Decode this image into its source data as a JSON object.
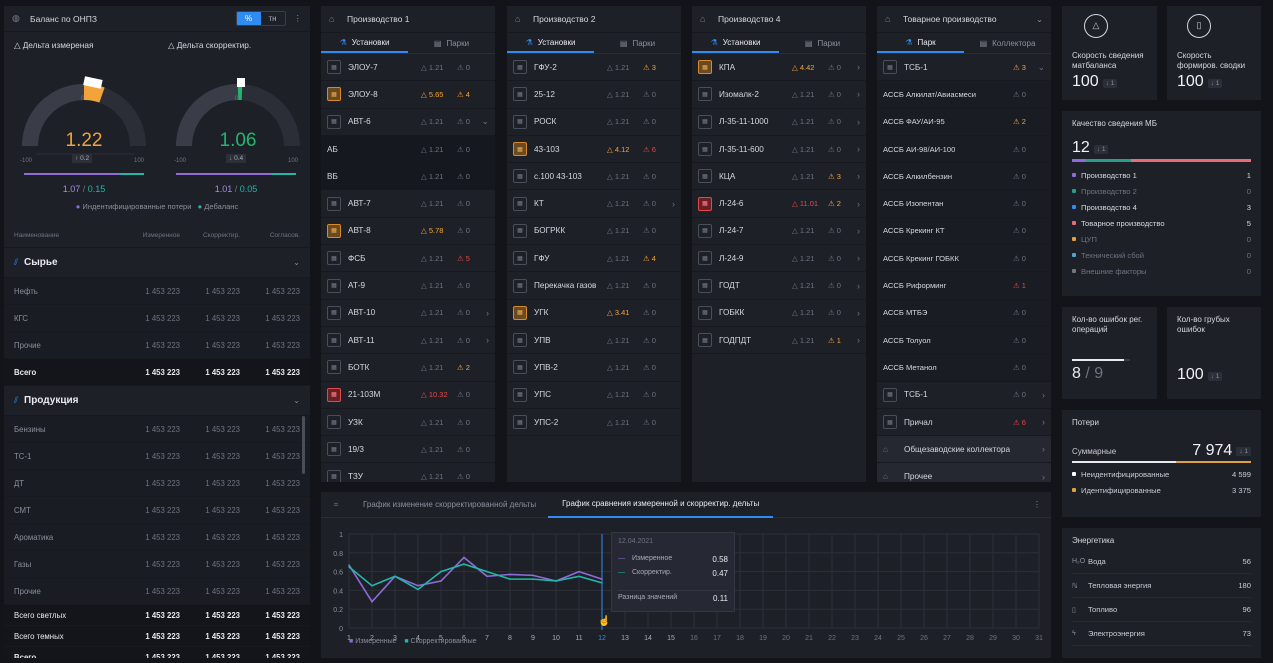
{
  "balance": {
    "title": "Баланс по ОНПЗ",
    "toggle": [
      "%",
      "тн"
    ],
    "g1": {
      "label": "Дельта измереная",
      "value": "1.22",
      "delta": "0.2",
      "min": "-100",
      "max": "100",
      "zero": "0",
      "a": "1.07",
      "b": "0.15"
    },
    "g2": {
      "label": "Дельта скорректир.",
      "value": "1.06",
      "delta": "0.4",
      "min": "-100",
      "max": "100",
      "zero": "0",
      "a": "1.01",
      "b": "0.05"
    },
    "legend": [
      "Индентифицированные потери",
      "Дебаланс"
    ],
    "cols": [
      "Наименование",
      "Измеренное",
      "Скорректир.",
      "Согласов."
    ],
    "raw": {
      "title": "Сырье",
      "rows": [
        [
          "Нефть",
          "1 453 223",
          "1 453 223",
          "1 453 223"
        ],
        [
          "КГС",
          "1 453 223",
          "1 453 223",
          "1 453 223"
        ],
        [
          "Прочие",
          "1 453 223",
          "1 453 223",
          "1 453 223"
        ]
      ],
      "total": [
        "Всего",
        "1 453 223",
        "1 453 223",
        "1 453 223"
      ]
    },
    "prod": {
      "title": "Продукция",
      "rows": [
        [
          "Бензины",
          "1 453 223",
          "1 453 223",
          "1 453 223"
        ],
        [
          "ТС-1",
          "1 453 223",
          "1 453 223",
          "1 453 223"
        ],
        [
          "ДТ",
          "1 453 223",
          "1 453 223",
          "1 453 223"
        ],
        [
          "СМТ",
          "1 453 223",
          "1 453 223",
          "1 453 223"
        ],
        [
          "Ароматика",
          "1 453 223",
          "1 453 223",
          "1 453 223"
        ],
        [
          "Газы",
          "1 453 223",
          "1 453 223",
          "1 453 223"
        ],
        [
          "Прочие",
          "1 453 223",
          "1 453 223",
          "1 453 223"
        ]
      ]
    },
    "totals": [
      [
        "Всего светлых",
        "1 453 223",
        "1 453 223",
        "1 453 223"
      ],
      [
        "Всего темных",
        "1 453 223",
        "1 453 223",
        "1 453 223"
      ],
      [
        "Всего",
        "1 453 223",
        "1 453 223",
        "1 453 223"
      ]
    ]
  },
  "p1": {
    "title": "Производство 1",
    "tabs": [
      "Установки",
      "Парки"
    ],
    "rows": [
      {
        "n": "ЭЛОУ-7",
        "a": "1.21",
        "b": "0",
        "s": ""
      },
      {
        "n": "ЭЛОУ-8",
        "a": "5.65",
        "b": "4",
        "s": "o",
        "ao": "o",
        "bo": "o"
      },
      {
        "n": "АВТ-6",
        "a": "1.21",
        "b": "0",
        "s": "",
        "ch": "⌄"
      },
      {
        "n": "АБ",
        "a": "1.21",
        "b": "0",
        "s": "none",
        "dark": 1
      },
      {
        "n": "ВБ",
        "a": "1.21",
        "b": "0",
        "s": "none",
        "dark": 1
      },
      {
        "n": "АВТ-7",
        "a": "1.21",
        "b": "0",
        "s": ""
      },
      {
        "n": "АВТ-8",
        "a": "5.78",
        "b": "0",
        "s": "o",
        "ao": "o"
      },
      {
        "n": "ФСБ",
        "a": "1.21",
        "b": "5",
        "s": "",
        "bo": "r"
      },
      {
        "n": "АТ-9",
        "a": "1.21",
        "b": "0",
        "s": ""
      },
      {
        "n": "АВТ-10",
        "a": "1.21",
        "b": "0",
        "s": "",
        "ch": "›"
      },
      {
        "n": "АВТ-11",
        "a": "1.21",
        "b": "0",
        "s": "",
        "ch": "›"
      },
      {
        "n": "БОТК",
        "a": "1.21",
        "b": "2",
        "s": "",
        "bo": "o"
      },
      {
        "n": "21-103М",
        "a": "10.32",
        "b": "0",
        "s": "r",
        "ao": "r"
      },
      {
        "n": "УЗК",
        "a": "1.21",
        "b": "0",
        "s": ""
      },
      {
        "n": "19/3",
        "a": "1.21",
        "b": "0",
        "s": ""
      },
      {
        "n": "ТЗУ",
        "a": "1.21",
        "b": "0",
        "s": ""
      }
    ]
  },
  "p2": {
    "title": "Производство 2",
    "tabs": [
      "Установки",
      "Парки"
    ],
    "rows": [
      {
        "n": "ГФУ-2",
        "a": "1.21",
        "b": "3",
        "s": "",
        "bo": "o"
      },
      {
        "n": "25-12",
        "a": "1.21",
        "b": "0",
        "s": ""
      },
      {
        "n": "РОСК",
        "a": "1.21",
        "b": "0",
        "s": ""
      },
      {
        "n": "43-103",
        "a": "4.12",
        "b": "6",
        "s": "o",
        "ao": "o",
        "bo": "r"
      },
      {
        "n": "с.100 43-103",
        "a": "1.21",
        "b": "0",
        "s": ""
      },
      {
        "n": "КТ",
        "a": "1.21",
        "b": "0",
        "s": "",
        "ch": "›"
      },
      {
        "n": "БОГРКК",
        "a": "1.21",
        "b": "0",
        "s": ""
      },
      {
        "n": "ГФУ",
        "a": "1.21",
        "b": "4",
        "s": "",
        "bo": "o"
      },
      {
        "n": "Перекачка газов",
        "a": "1.21",
        "b": "0",
        "s": ""
      },
      {
        "n": "УГК",
        "a": "3.41",
        "b": "0",
        "s": "o",
        "ao": "o"
      },
      {
        "n": "УПВ",
        "a": "1.21",
        "b": "0",
        "s": ""
      },
      {
        "n": "УПВ-2",
        "a": "1.21",
        "b": "0",
        "s": ""
      },
      {
        "n": "УПС",
        "a": "1.21",
        "b": "0",
        "s": ""
      },
      {
        "n": "УПС-2",
        "a": "1.21",
        "b": "0",
        "s": ""
      }
    ]
  },
  "p4": {
    "title": "Производство 4",
    "tabs": [
      "Установки",
      "Парки"
    ],
    "rows": [
      {
        "n": "КПА",
        "a": "4.42",
        "b": "0",
        "s": "o",
        "ao": "o",
        "ch": "›"
      },
      {
        "n": "Изомалк-2",
        "a": "1.21",
        "b": "0",
        "s": "",
        "ch": "›"
      },
      {
        "n": "Л-35-11-1000",
        "a": "1.21",
        "b": "0",
        "s": "",
        "ch": "›"
      },
      {
        "n": "Л-35-11-600",
        "a": "1.21",
        "b": "0",
        "s": "",
        "ch": "›"
      },
      {
        "n": "КЦА",
        "a": "1.21",
        "b": "3",
        "s": "",
        "bo": "o",
        "ch": "›"
      },
      {
        "n": "Л-24-6",
        "a": "11.01",
        "b": "2",
        "s": "r",
        "ao": "r",
        "bo": "o",
        "ch": "›"
      },
      {
        "n": "Л-24-7",
        "a": "1.21",
        "b": "0",
        "s": "",
        "ch": "›"
      },
      {
        "n": "Л-24-9",
        "a": "1.21",
        "b": "0",
        "s": "",
        "ch": "›"
      },
      {
        "n": "ГОДТ",
        "a": "1.21",
        "b": "0",
        "s": "",
        "ch": "›"
      },
      {
        "n": "ГОБКК",
        "a": "1.21",
        "b": "0",
        "s": "",
        "ch": "›"
      },
      {
        "n": "ГОДПДТ",
        "a": "1.21",
        "b": "1",
        "s": "",
        "bo": "o",
        "ch": "›"
      }
    ]
  },
  "tp": {
    "title": "Товарное производство",
    "tabs": [
      "Парк",
      "Коллектора"
    ],
    "rows": [
      {
        "n": "ТСБ-1",
        "b": "3",
        "bo": "o",
        "ch": "⌄",
        "box": 1
      },
      {
        "n": "АССБ Алкилат/Авиасмеси",
        "b": "0"
      },
      {
        "n": "АССБ ФАУ/АИ-95",
        "b": "2",
        "bo": "o"
      },
      {
        "n": "АССБ АИ-98/АИ-100",
        "b": "0"
      },
      {
        "n": "АССБ Алкилбензин",
        "b": "0"
      },
      {
        "n": "АССБ Изопентан",
        "b": "0"
      },
      {
        "n": "АССБ Крекинг КТ",
        "b": "0"
      },
      {
        "n": "АССБ Крекинг ГОБКК",
        "b": "0"
      },
      {
        "n": "АССБ Риформинг",
        "b": "1",
        "bo": "r"
      },
      {
        "n": "АССБ МТБЭ",
        "b": "0"
      },
      {
        "n": "АССБ Толуол",
        "b": "0"
      },
      {
        "n": "АССБ Метанол",
        "b": "0"
      },
      {
        "n": "ТСБ-1",
        "b": "0",
        "ch": "›",
        "box": 1
      },
      {
        "n": "Причал",
        "b": "6",
        "bo": "r",
        "ch": "›",
        "box": 1
      }
    ],
    "sections": [
      "Общезаводские коллектора",
      "Прочее"
    ]
  },
  "kpi1": {
    "label": "Скорость сведения матбаланса",
    "value": "100",
    "badge": "1"
  },
  "kpi2": {
    "label": "Скорость формиров. сводки",
    "value": "100",
    "badge": "1"
  },
  "quality": {
    "title": "Качество сведения МБ",
    "value": "12",
    "badge": "1",
    "items": [
      {
        "l": "Производство 1",
        "v": "1",
        "c": "#8e6bd6"
      },
      {
        "l": "Производство 2",
        "v": "0",
        "c": "#2b9c8a"
      },
      {
        "l": "Производство 4",
        "v": "3",
        "c": "#2f8cf0"
      },
      {
        "l": "Товарное производство",
        "v": "5",
        "c": "#e86b79"
      },
      {
        "l": "ЦУП",
        "v": "0",
        "c": "#e0a040"
      },
      {
        "l": "Технический сбой",
        "v": "0",
        "c": "#4aa6c4"
      },
      {
        "l": "Внешние факторы",
        "v": "0",
        "c": "#777"
      }
    ]
  },
  "err1": {
    "label": "Кол-во ошибок рег. операций",
    "a": "8",
    "b": "9",
    "progress": 0.89
  },
  "err2": {
    "label": "Кол-во грубых ошибок",
    "value": "100",
    "badge": "1"
  },
  "loss": {
    "title": "Потери",
    "sum_label": "Суммарные",
    "sum": "7 974",
    "badge": "1",
    "items": [
      {
        "l": "Неидентифицированные",
        "v": "4 599",
        "c": "#ffffff"
      },
      {
        "l": "Идентифицированные",
        "v": "3 375",
        "c": "#e0a040"
      }
    ]
  },
  "energy": {
    "title": "Энергетика",
    "items": [
      {
        "l": "Вода",
        "v": "56",
        "i": "H₂O"
      },
      {
        "l": "Тепловая энергия",
        "v": "180",
        "i": "ℕ"
      },
      {
        "l": "Топливо",
        "v": "96",
        "i": "▯"
      },
      {
        "l": "Электроэнергия",
        "v": "73",
        "i": "ϟ"
      }
    ]
  },
  "chart_tabs": [
    "График изменение скорректированной дельты",
    "График сравнения измеренной и скорректир. дельты"
  ],
  "tooltip": {
    "date": "12.04.2021",
    "r1": "Измеренное",
    "v1": "0.58",
    "r2": "Скорректир.",
    "v2": "0.47",
    "r3": "Разница значений",
    "v3": "0.11"
  },
  "chart_data": {
    "type": "line",
    "x": [
      1,
      2,
      3,
      4,
      5,
      6,
      7,
      8,
      9,
      10,
      11,
      12
    ],
    "xticks": [
      1,
      2,
      3,
      4,
      5,
      6,
      7,
      8,
      9,
      10,
      11,
      12,
      13,
      14,
      15,
      16,
      17,
      18,
      19,
      20,
      21,
      22,
      23,
      24,
      25,
      26,
      27,
      28,
      29,
      30,
      31
    ],
    "yticks": [
      0,
      0.2,
      0.4,
      0.6,
      0.8,
      1
    ],
    "ylim": [
      0,
      1
    ],
    "series": [
      {
        "name": "Измеренные",
        "color": "#8e6bd6",
        "values": [
          0.67,
          0.28,
          0.55,
          0.45,
          0.5,
          0.75,
          0.55,
          0.57,
          0.56,
          0.5,
          0.6,
          0.52
        ]
      },
      {
        "name": "Скорректированные",
        "color": "#22b6a8",
        "values": [
          0.65,
          0.45,
          0.55,
          0.41,
          0.6,
          0.68,
          0.6,
          0.52,
          0.52,
          0.5,
          0.55,
          0.48
        ]
      }
    ],
    "legend_names": [
      "Измеренные",
      "Скорректированные"
    ]
  }
}
